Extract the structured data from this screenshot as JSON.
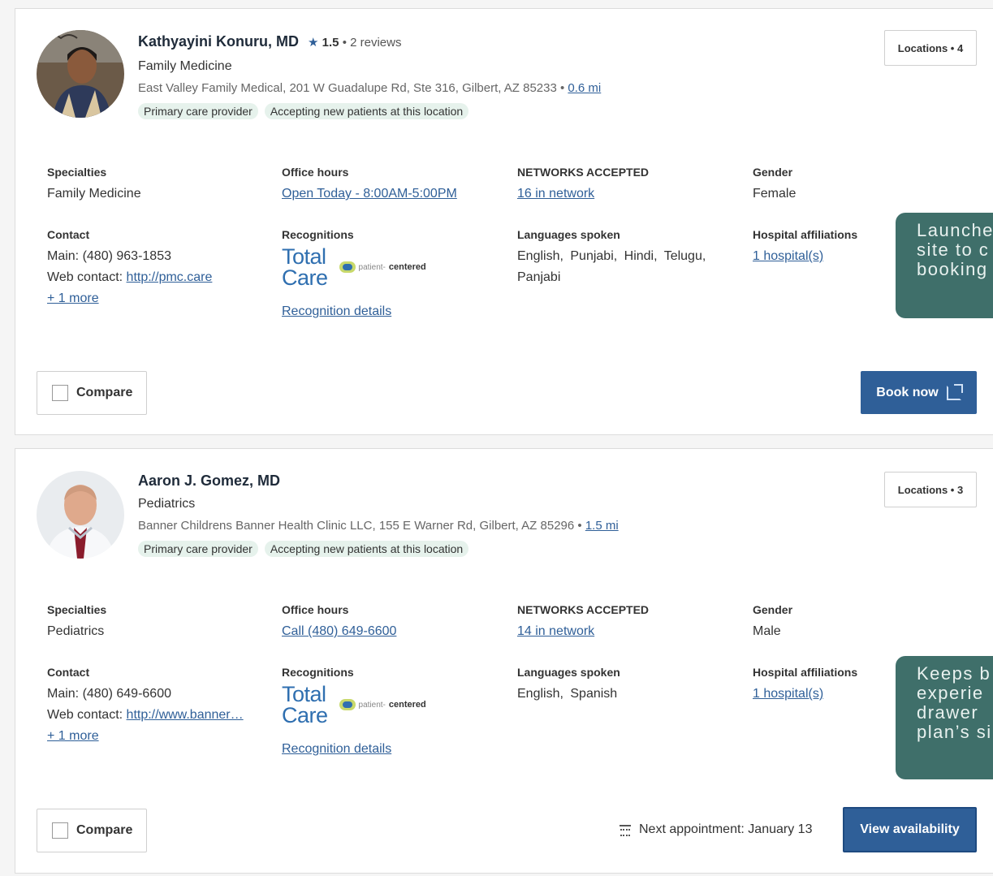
{
  "providers": [
    {
      "name": "Kathyayini Konuru, MD",
      "rating": "1.5",
      "reviews": "• 2 reviews",
      "specialty": "Family Medicine",
      "address": "East Valley Family Medical, 201 W Guadalupe Rd, Ste 316, Gilbert, AZ 85233 •",
      "distance": "0.6 mi",
      "tags": [
        "Primary care provider",
        "Accepting new patients at this location"
      ],
      "locations_label": "Locations • 4",
      "specialties_label": "Specialties",
      "specialties_value": "Family Medicine",
      "office_hours_label": "Office hours",
      "office_hours_value": "Open Today - 8:00AM-5:00PM",
      "networks_label": "NETWORKS ACCEPTED",
      "networks_value": "16 in network",
      "gender_label": "Gender",
      "gender_value": "Female",
      "contact_label": "Contact",
      "contact_main": "Main: (480) 963-1853",
      "web_contact_label": "Web contact:",
      "web_contact_value": "http://pmc.care",
      "more_link": "+ 1 more",
      "recognitions_label": "Recognitions",
      "total_care_top": "Total",
      "total_care_bottom": "Care",
      "pcmh_text_a": "patient-",
      "pcmh_text_b": "centered",
      "recognition_details": "Recognition details",
      "languages_label": "Languages spoken",
      "languages_value": "English, Punjabi, Hindi, Telugu, Panjabi",
      "hospital_label": "Hospital affiliations",
      "hospital_value": "1 hospital(s)",
      "compare_label": "Compare",
      "action_label": "Book now"
    },
    {
      "name": "Aaron J. Gomez, MD",
      "specialty": "Pediatrics",
      "address": "Banner Childrens Banner Health Clinic LLC, 155 E Warner Rd, Gilbert, AZ 85296 •",
      "distance": "1.5 mi",
      "tags": [
        "Primary care provider",
        "Accepting new patients at this location"
      ],
      "locations_label": "Locations • 3",
      "specialties_label": "Specialties",
      "specialties_value": "Pediatrics",
      "office_hours_label": "Office hours",
      "office_hours_value": "Call (480) 649-6600",
      "networks_label": "NETWORKS ACCEPTED",
      "networks_value": "14 in network",
      "gender_label": "Gender",
      "gender_value": "Male",
      "contact_label": "Contact",
      "contact_main": "Main: (480) 649-6600",
      "web_contact_label": "Web contact:",
      "web_contact_value": "http://www.banner…",
      "more_link": "+ 1 more",
      "recognitions_label": "Recognitions",
      "total_care_top": "Total",
      "total_care_bottom": "Care",
      "pcmh_text_a": "patient-",
      "pcmh_text_b": "centered",
      "recognition_details": "Recognition details",
      "languages_label": "Languages spoken",
      "languages_value": "English, Spanish",
      "hospital_label": "Hospital affiliations",
      "hospital_value": "1 hospital(s)",
      "compare_label": "Compare",
      "next_appointment": "Next appointment: January 13",
      "action_label": "View availability"
    }
  ],
  "tooltips": [
    {
      "lines": [
        "Launche",
        "site to c",
        "booking"
      ]
    },
    {
      "lines": [
        "Keeps b",
        "experie",
        "drawer",
        "plan’s si"
      ]
    }
  ],
  "colors": {
    "accent": "#2f5f98",
    "tag_bg": "#e6f2ec",
    "tooltip_bg": "#3f6f6a"
  }
}
